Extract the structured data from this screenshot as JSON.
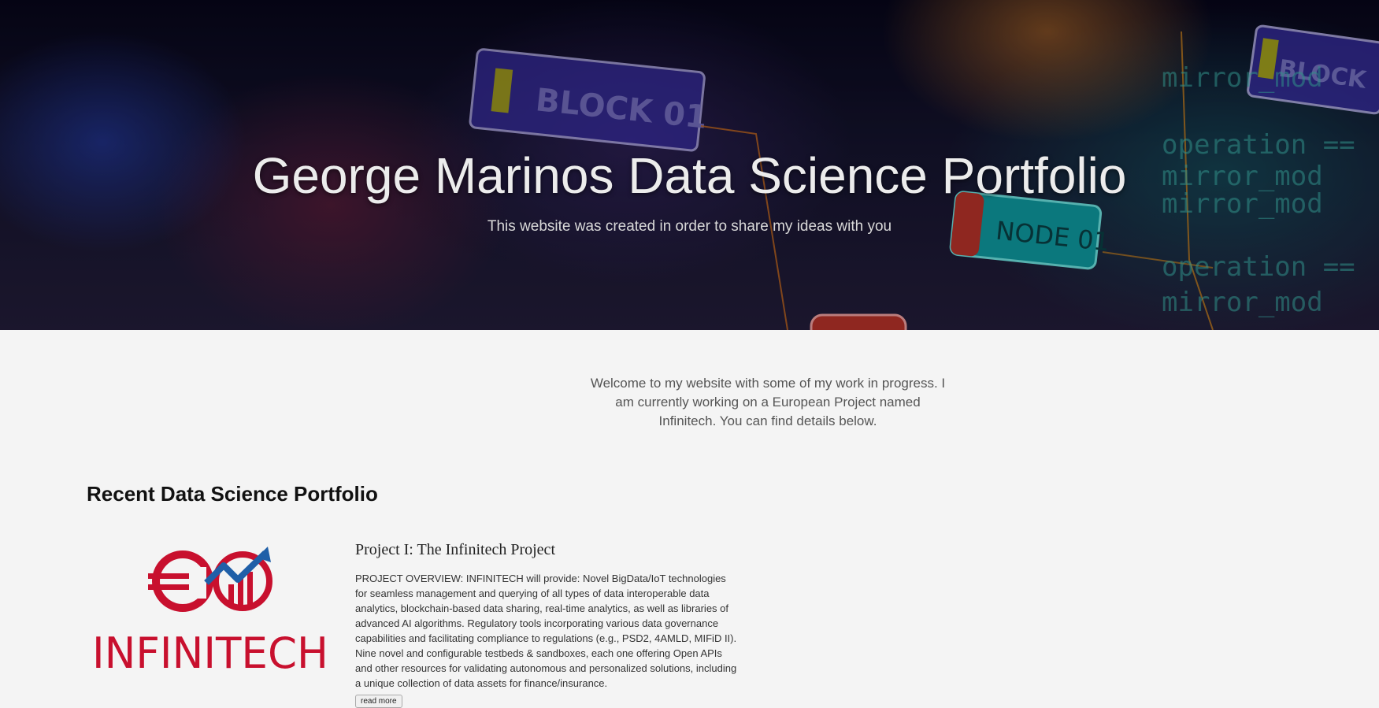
{
  "hero": {
    "title": "George Marinos Data Science Portfolio",
    "subtitle": "This website was created in order to share my ideas with you",
    "background_texts": [
      "BLOCK 01",
      "NODE 01",
      "BLOCK",
      "mirror_mod",
      "operation =="
    ]
  },
  "intro": {
    "text": "Welcome to my website with some of my work in progress. I am currently working on a European Project named Infinitech. You can find details below."
  },
  "portfolio": {
    "heading": "Recent Data Science Portfolio",
    "projects": [
      {
        "logo_text": "INFINITECH",
        "title": "Project I: The Infinitech Project",
        "description": "PROJECT OVERVIEW: INFINITECH will provide: Novel BigData/IoT technologies for seamless management and querying of all types of data interoperable data analytics, blockchain-based data sharing, real-time analytics, as well as libraries of advanced AI algorithms. Regulatory tools incorporating various data governance capabilities and facilitating compliance to regulations (e.g., PSD2, 4AMLD, MIFiD II). Nine novel and configurable testbeds & sandboxes, each one offering Open APIs and other resources for validating autonomous and personalized solutions, including a unique collection of data assets for finance/insurance.",
        "read_more_label": "read more"
      }
    ]
  },
  "colors": {
    "logo_red": "#c8102e",
    "logo_blue": "#1f5fa8",
    "page_bg": "#f4f4f4"
  }
}
